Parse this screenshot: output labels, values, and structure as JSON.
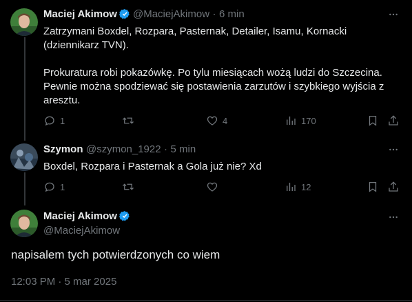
{
  "tweets": [
    {
      "author": "Maciej Akimow",
      "handle": "@MaciejAkimow",
      "separator": "·",
      "time": "6 min",
      "text_lines": [
        "Zatrzymani Boxdel, Rozpara, Pasternak, Detailer, Isamu, Kornacki",
        "(dziennikarz TVN).",
        "",
        "Prokuratura robi pokazówkę. Po tylu miesiącach wożą ludzi do Szczecina.",
        "Pewnie można spodziewać się postawienia zarzutów i szybkiego wyjścia z",
        "aresztu."
      ],
      "stats": {
        "replies": "1",
        "reposts": "",
        "likes": "4",
        "views": "170"
      }
    },
    {
      "author": "Szymon",
      "handle": "@szymon_1922",
      "separator": "·",
      "time": "5 min",
      "text_lines": [
        "Boxdel, Rozpara i Pasternak a Gola już nie? Xd"
      ],
      "stats": {
        "replies": "1",
        "reposts": "",
        "likes": "",
        "views": "12"
      }
    }
  ],
  "main_tweet": {
    "author": "Maciej Akimow",
    "handle": "@MaciejAkimow",
    "text": "napisalem tych potwierdzonych co wiem",
    "timestamp": "12:03 PM · 5 mar 2025"
  },
  "icons": {
    "reply": "reply-icon",
    "repost": "repost-icon",
    "like": "heart-icon",
    "views": "views-icon",
    "bookmark": "bookmark-icon",
    "share": "share-icon",
    "more": "more-icon",
    "verified": "verified-badge-icon"
  },
  "colors": {
    "background": "#000000",
    "text": "#e7e9ea",
    "secondary": "#71767b",
    "verified": "#1d9bf0",
    "divider": "#2f3336"
  }
}
